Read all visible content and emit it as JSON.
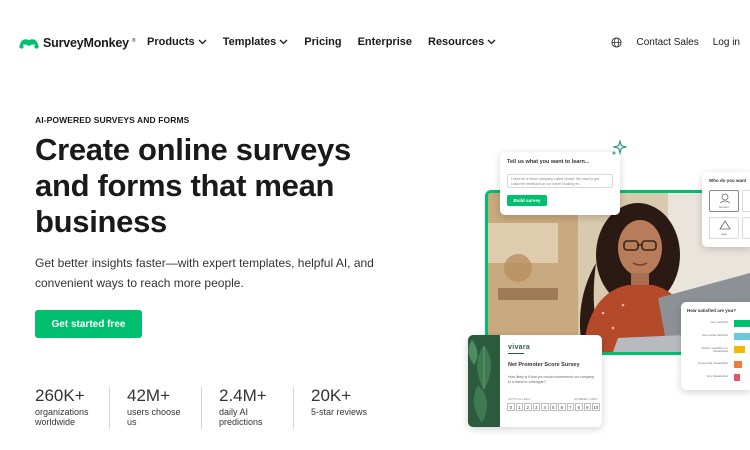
{
  "brand": {
    "name": "SurveyMonkey",
    "accent_color": "#00bf6f",
    "dark_green": "#2c5a3d"
  },
  "nav": {
    "links": [
      {
        "label": "Products",
        "has_dropdown": true
      },
      {
        "label": "Templates",
        "has_dropdown": true
      },
      {
        "label": "Pricing",
        "has_dropdown": false
      },
      {
        "label": "Enterprise",
        "has_dropdown": false
      },
      {
        "label": "Resources",
        "has_dropdown": true
      }
    ],
    "globe_icon": "globe-icon",
    "contact_sales": "Contact Sales",
    "login": "Log in"
  },
  "hero": {
    "eyebrow": "AI-POWERED SURVEYS AND FORMS",
    "headline": "Create online surveys and forms that mean business",
    "subhead": "Get better insights faster—with expert templates, helpful AI, and convenient ways to reach more people.",
    "cta": "Get started free"
  },
  "stats": [
    {
      "value": "260K+",
      "label": "organizations worldwide"
    },
    {
      "value": "42M+",
      "label": "users choose us"
    },
    {
      "value": "2.4M+",
      "label": "daily AI predictions"
    },
    {
      "value": "20K+",
      "label": "5-star reviews"
    }
  ],
  "cards": {
    "learn": {
      "title": "Tell us what you want to learn...",
      "field_text": "I work for a travel company called Vivara. We want to get customer feedback on our travel booking ex...",
      "button": "Build survey"
    },
    "who": {
      "title": "Who do you want",
      "options": [
        "Gender",
        "Age"
      ]
    },
    "satisfied": {
      "title": "How satisfied are you?",
      "rows": [
        {
          "label": "Very satisfied",
          "color": "#00bf6f",
          "level": 1.0
        },
        {
          "label": "Somewhat satisfied",
          "color": "#6bc8d8",
          "level": 0.75
        },
        {
          "label": "Neither satisfied nor dissatisfied",
          "color": "#f5b800",
          "level": 0.5
        },
        {
          "label": "Somewhat dissatisfied",
          "color": "#f07a3a",
          "level": 0.35
        },
        {
          "label": "Very dissatisfied",
          "color": "#e0566b",
          "level": 0.25
        }
      ]
    },
    "nps": {
      "logo": "vivara",
      "title": "Net Promoter Score Survey",
      "question": "How likely is it that you would recommend our company to a friend or colleague?",
      "low_label": "NOT AT ALL LIKELY",
      "high_label": "EXTREMELY LIKELY",
      "scale": [
        "0",
        "1",
        "2",
        "3",
        "4",
        "5",
        "6",
        "7",
        "8",
        "9",
        "10"
      ]
    }
  }
}
